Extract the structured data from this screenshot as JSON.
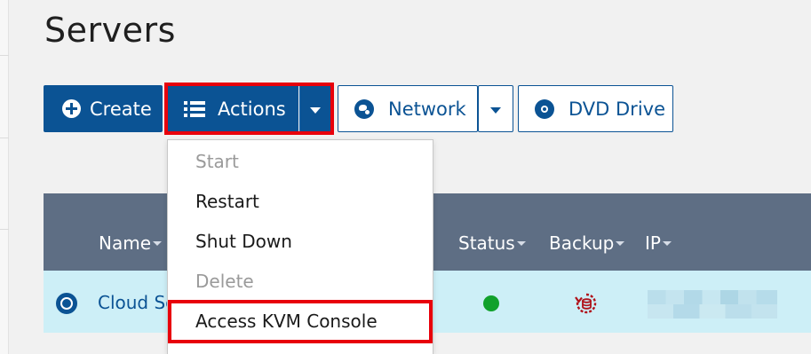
{
  "page": {
    "title": "Servers"
  },
  "toolbar": {
    "create_label": "Create",
    "actions_label": "Actions",
    "network_label": "Network",
    "dvd_label": "DVD Drive"
  },
  "actions_menu": {
    "items": [
      {
        "label": "Start",
        "enabled": false
      },
      {
        "label": "Restart",
        "enabled": true
      },
      {
        "label": "Shut Down",
        "enabled": true
      },
      {
        "label": "Delete",
        "enabled": false
      },
      {
        "label": "Access KVM Console",
        "enabled": true,
        "highlighted": true
      }
    ]
  },
  "table": {
    "columns": [
      "Name",
      "Status",
      "Backup",
      "IP"
    ],
    "rows": [
      {
        "name": "Cloud Se",
        "status": "online",
        "backup_icon": "backup-restore-icon",
        "ip": ""
      }
    ]
  },
  "colors": {
    "primary": "#0b5394",
    "highlight_border": "#e8000b",
    "header_bg": "#5e6e84",
    "row_selected_bg": "#cdeff7",
    "status_online": "#11a12c",
    "backup_icon": "#b0121a"
  }
}
